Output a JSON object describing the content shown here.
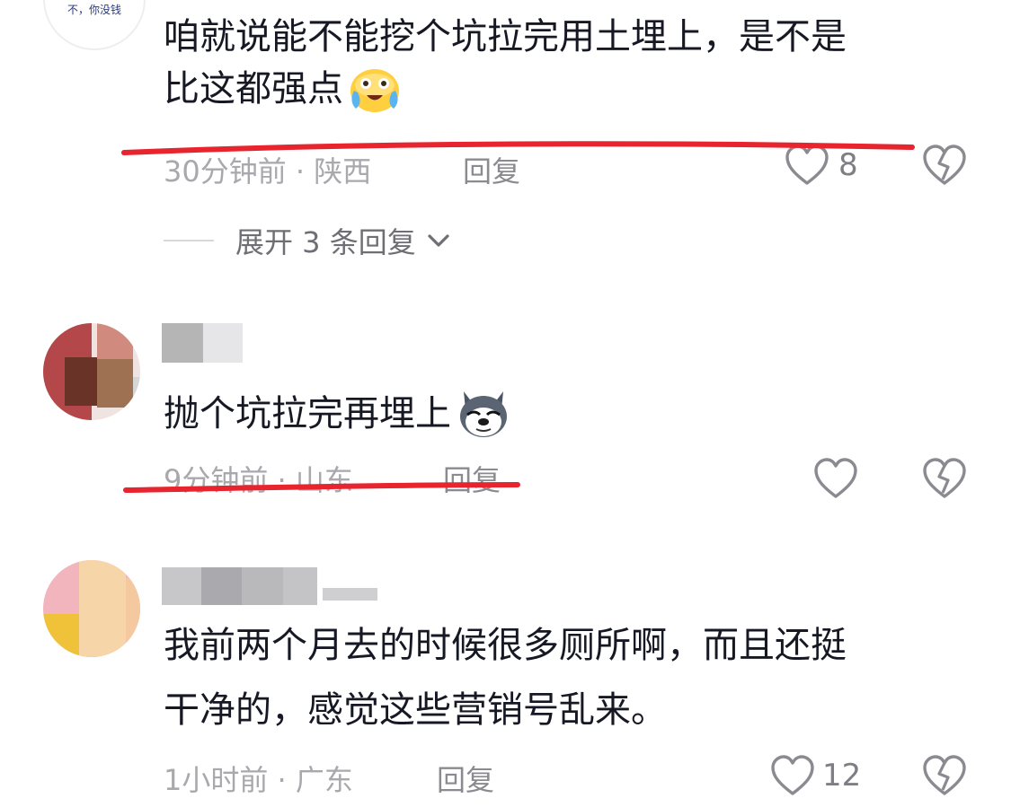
{
  "comments": [
    {
      "avatar_text": "不，你没钱",
      "text_line1": "咱就说能不能挖个坑拉完用土埋上，是不是",
      "text_line2": "比这都强点",
      "time_loc": "30分钟前 · 陕西",
      "reply_label": "回复",
      "likes": "8",
      "expand_label": "展开 3 条回复"
    },
    {
      "text_line1": "抛个坑拉完再埋上",
      "time_loc": "9分钟前 · 山东",
      "reply_label": "回复"
    },
    {
      "text_line1": "我前两个月去的时候很多厕所啊，而且还挺",
      "text_line2": "干净的，感觉这些营销号乱来。",
      "time_loc": "1小时前 · 广东",
      "reply_label": "回复",
      "likes": "12"
    }
  ],
  "colors": {
    "text": "#161823",
    "meta": "#a8a8ad",
    "annotation_red": "#e8242e"
  }
}
